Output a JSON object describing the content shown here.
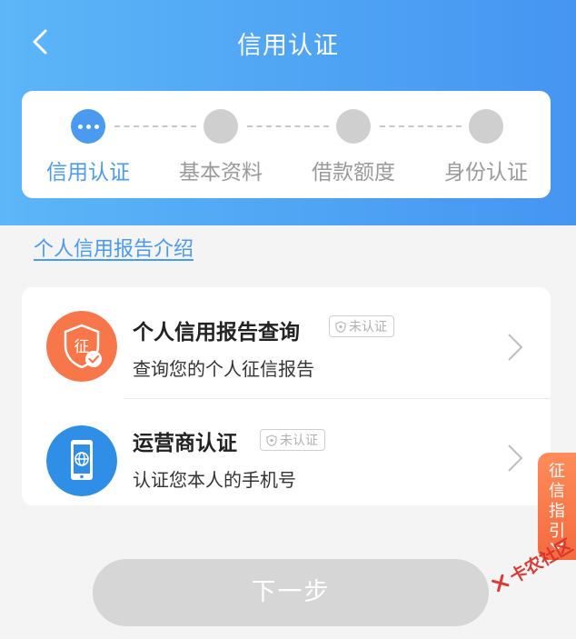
{
  "header": {
    "title": "信用认证",
    "back_icon": "chevron-left-icon",
    "gradient_from": "#5cb6f7",
    "gradient_to": "#4595f2"
  },
  "steps": [
    {
      "label": "信用认证",
      "state": "active"
    },
    {
      "label": "基本资料",
      "state": "pending"
    },
    {
      "label": "借款额度",
      "state": "pending"
    },
    {
      "label": "身份认证",
      "state": "pending"
    }
  ],
  "intro_link": "个人信用报告介绍",
  "items": [
    {
      "title": "个人信用报告查询",
      "badge": "未认证",
      "desc": "查询您的个人征信报告",
      "icon": "credit-shield-icon",
      "icon_text": "征",
      "icon_color": "#f7774a"
    },
    {
      "title": "运营商认证",
      "badge": "未认证",
      "desc": "认证您本人的手机号",
      "icon": "phone-globe-icon",
      "icon_color": "#2f8ee6"
    }
  ],
  "side_tab": {
    "text": "征信指引",
    "icon": "chevron-down-icon"
  },
  "next_button": "下一步",
  "watermark": "卡农社区",
  "colors": {
    "accent": "#4a9af0",
    "inactive": "#cfcfcf",
    "button_disabled": "#d6d6d6",
    "orange": "#f46a3e"
  }
}
